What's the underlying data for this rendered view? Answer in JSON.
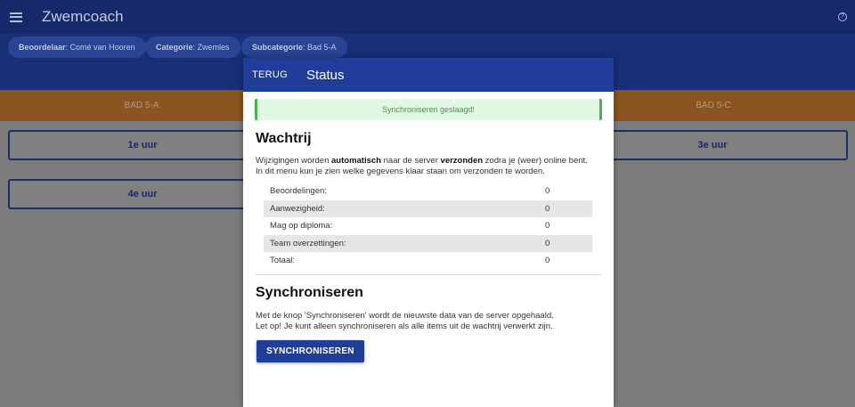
{
  "appbar": {
    "title": "Zwemcoach",
    "menu_icon": "hamburger-icon",
    "help_icon": "help-circle-icon"
  },
  "filters": [
    {
      "key": "Beoordelaar",
      "value": "Comé van Hooren"
    },
    {
      "key": "Categorie",
      "value": "Zwemles"
    },
    {
      "key": "Subcategorie",
      "value": "Bad 5-A"
    }
  ],
  "tabs": [
    "BAD 5-A",
    "BAD 5-C"
  ],
  "hours": [
    "1e uur",
    "3e uur",
    "4e uur"
  ],
  "dialog": {
    "back_label": "TERUG",
    "title": "Status",
    "success_message": "Synchroniseren geslaagd!",
    "queue": {
      "heading": "Wachtrij",
      "desc_part1": "Wijzigingen worden ",
      "desc_bold1": "automatisch",
      "desc_part2": " naar de server ",
      "desc_bold2": "verzonden",
      "desc_part3": " zodra je (weer) online bent.",
      "desc_line2": "In dit menu kun je zien welke gegevens klaar staan om verzonden te worden.",
      "rows": [
        {
          "label": "Beoordelingen:",
          "value": "0"
        },
        {
          "label": "Aanwezigheid:",
          "value": "0"
        },
        {
          "label": "Mag op diploma:",
          "value": "0"
        },
        {
          "label": "Team overzettingen:",
          "value": "0"
        },
        {
          "label": "Totaal:",
          "value": "0"
        }
      ]
    },
    "sync": {
      "heading": "Synchroniseren",
      "desc_line1": "Met de knop 'Synchroniseren' wordt de nieuwste data van de server opgehaald.",
      "desc_line2": "Let op! Je kunt alleen synchroniseren als alle items uit de wachtrij verwerkt zijn.",
      "button_label": "SYNCHRONISEREN"
    }
  },
  "colors": {
    "primary": "#203d99",
    "accent": "#e8913a",
    "success": "#4caf50"
  }
}
